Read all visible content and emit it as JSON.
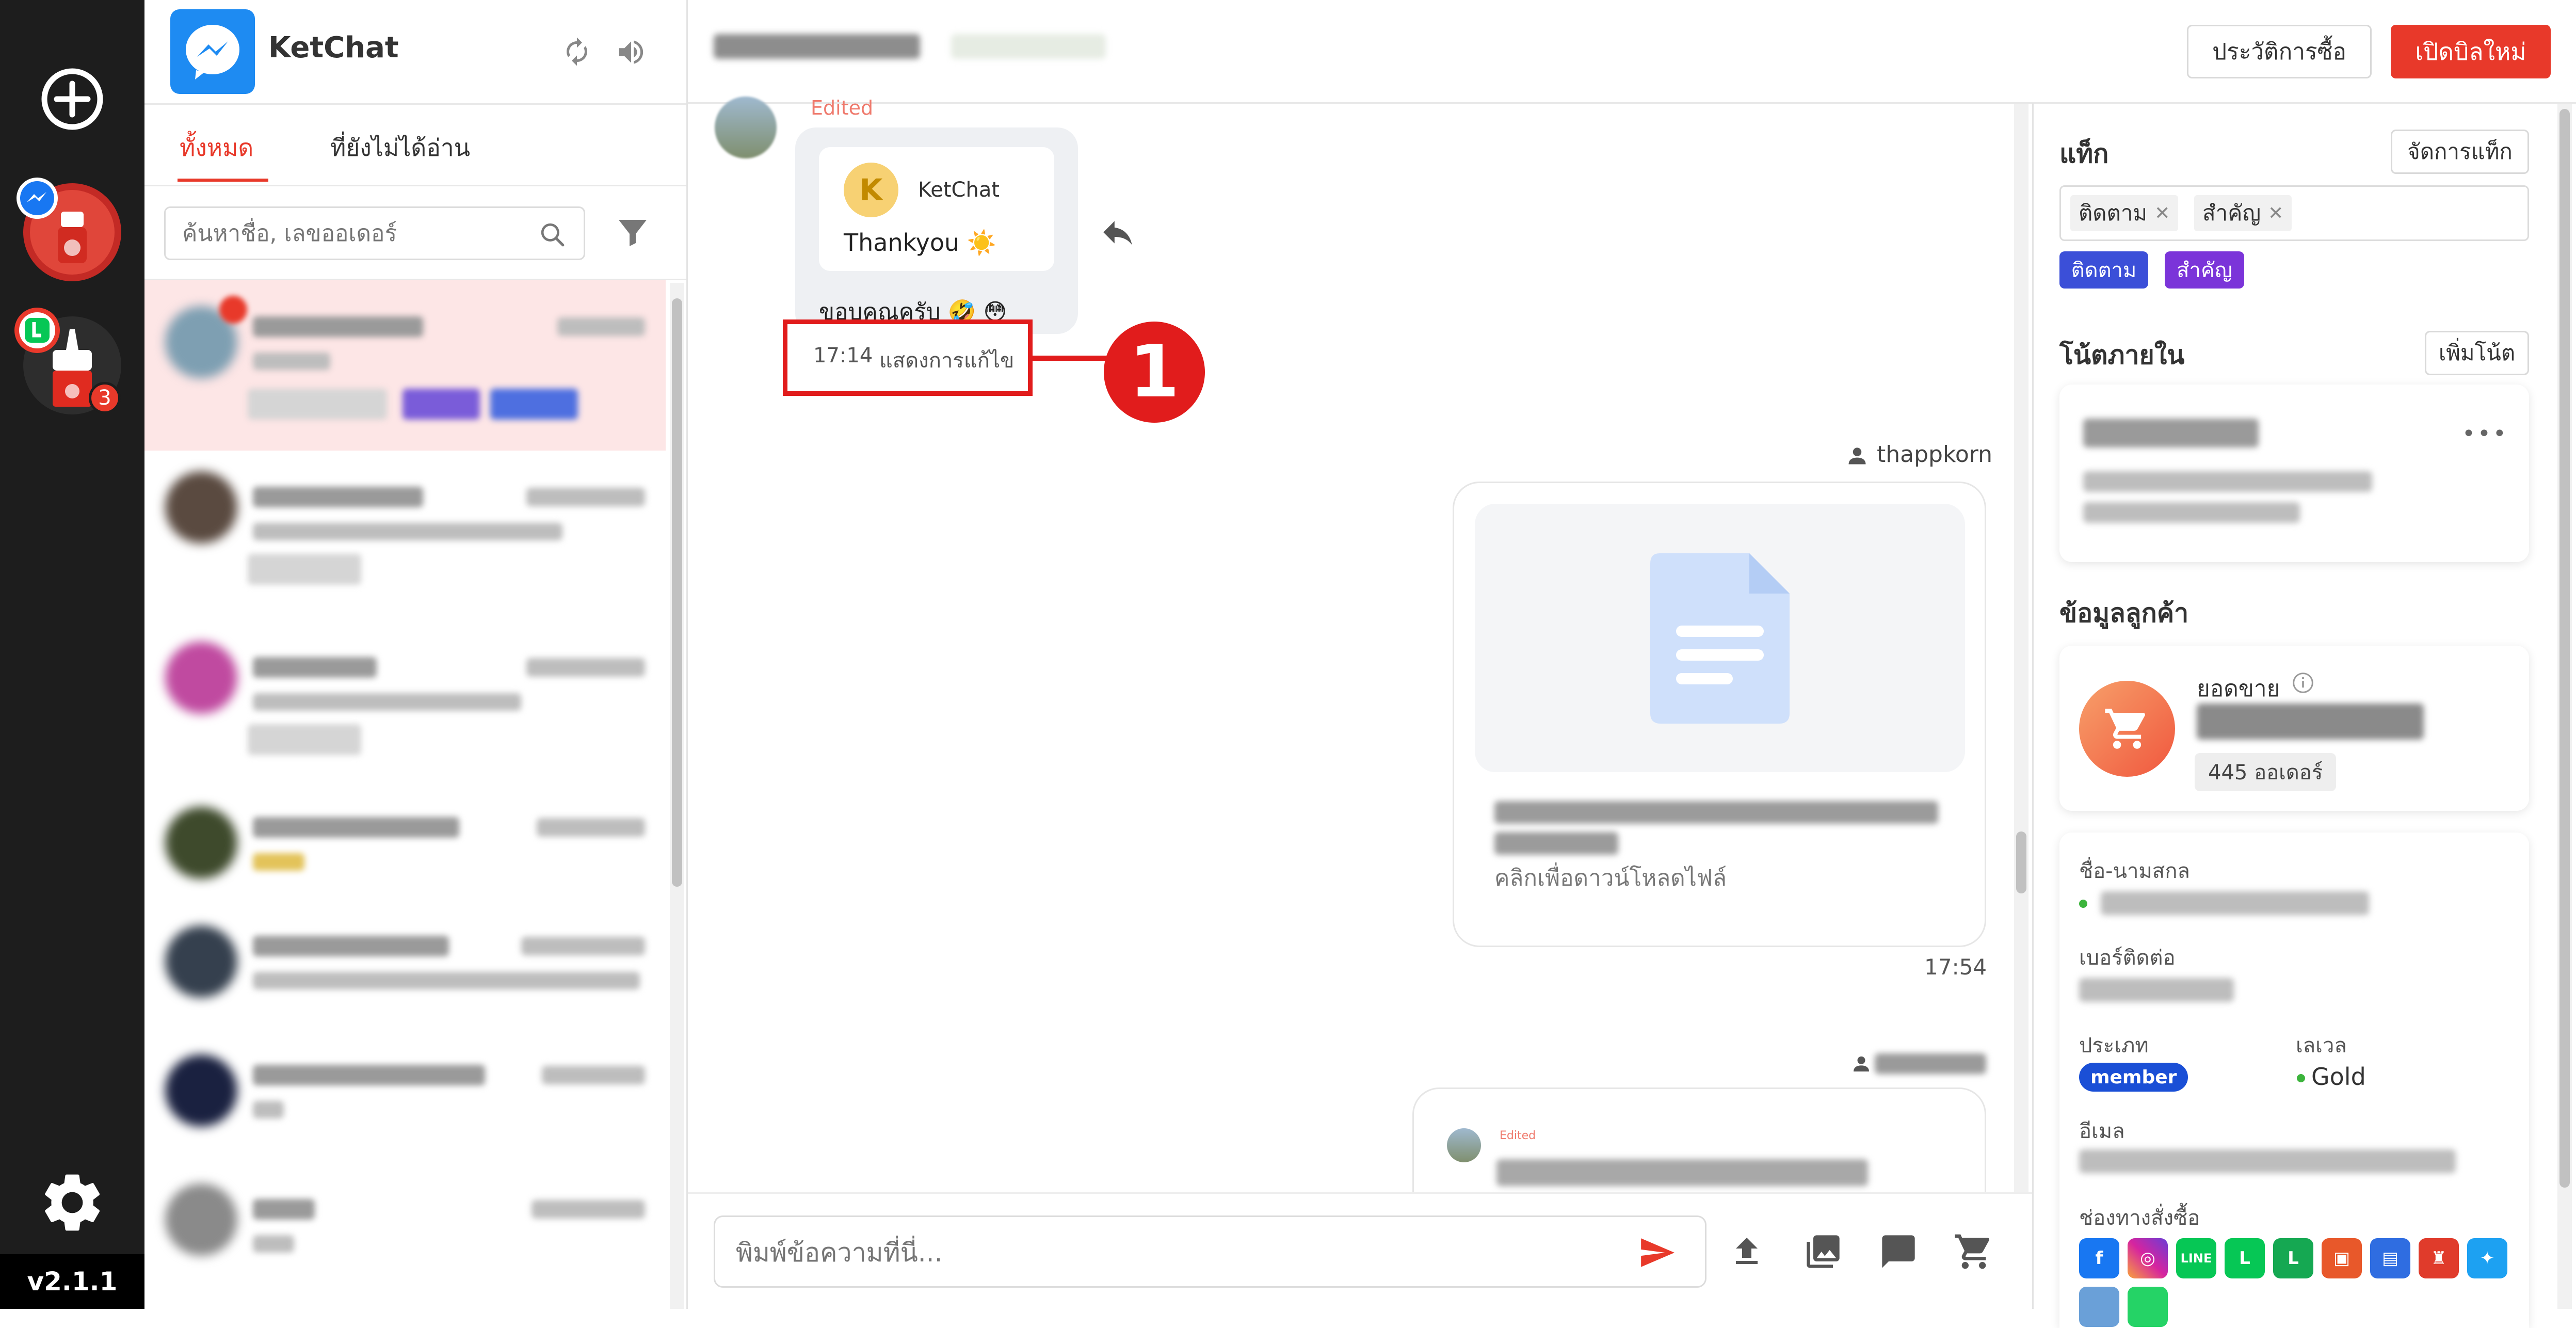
{
  "app": {
    "name": "KetChat",
    "version": "v2.1.1"
  },
  "rail": {
    "line_badge_count": "3"
  },
  "inbox": {
    "tabs": [
      "ทั้งหมด",
      "ที่ยังไม่ได้อ่าน"
    ],
    "search_placeholder": "ค้นหาชื่อ, เลขออเดอร์"
  },
  "header": {
    "history_button": "ประวัติการซื้อ",
    "new_bill_button": "เปิดบิลใหม่"
  },
  "chat": {
    "edited_label": "Edited",
    "quote_sender": "KetChat",
    "quote_avatar_letter": "K",
    "quote_text": "Thankyou ☀️",
    "message_text": "ขอบคุณครับ 🤣 😳",
    "message_time": "17:14",
    "show_edits": "แสดงการแก้ไข",
    "callout_number": "1",
    "file_sender": "thappkorn",
    "file_hint": "คลิกเพื่อดาวน์โหลดไฟล์",
    "file_time": "17:54",
    "edited_small": "Edited",
    "input_placeholder": "พิมพ์ข้อความที่นี่..."
  },
  "right": {
    "tags_title": "แท็ก",
    "manage_tags_button": "จัดการแท็ก",
    "selected_tags": [
      "ติดตาม",
      "สำคัญ"
    ],
    "tag_chips": [
      {
        "label": "ติดตาม",
        "color": "#3b4fd8"
      },
      {
        "label": "สำคัญ",
        "color": "#7b34d9"
      }
    ],
    "notes_title": "โน้ตภายใน",
    "add_note_button": "เพิ่มโน้ต",
    "customer_title": "ข้อมูลลูกค้า",
    "sales_label": "ยอดขาย",
    "orders": "445 ออเดอร์",
    "name_label": "ชื่อ-นามสกล",
    "phone_label": "เบอร์ติดต่อ",
    "type_label": "ประเภท",
    "type_value": "member",
    "level_label": "เลเวล",
    "level_value": "Gold",
    "email_label": "อีเมล",
    "channels_label": "ช่องทางสั่งซื้อ"
  },
  "colors": {
    "brand_red": "#e8392a",
    "rail": "#1d1d1d",
    "messenger_blue": "#1877f2"
  }
}
